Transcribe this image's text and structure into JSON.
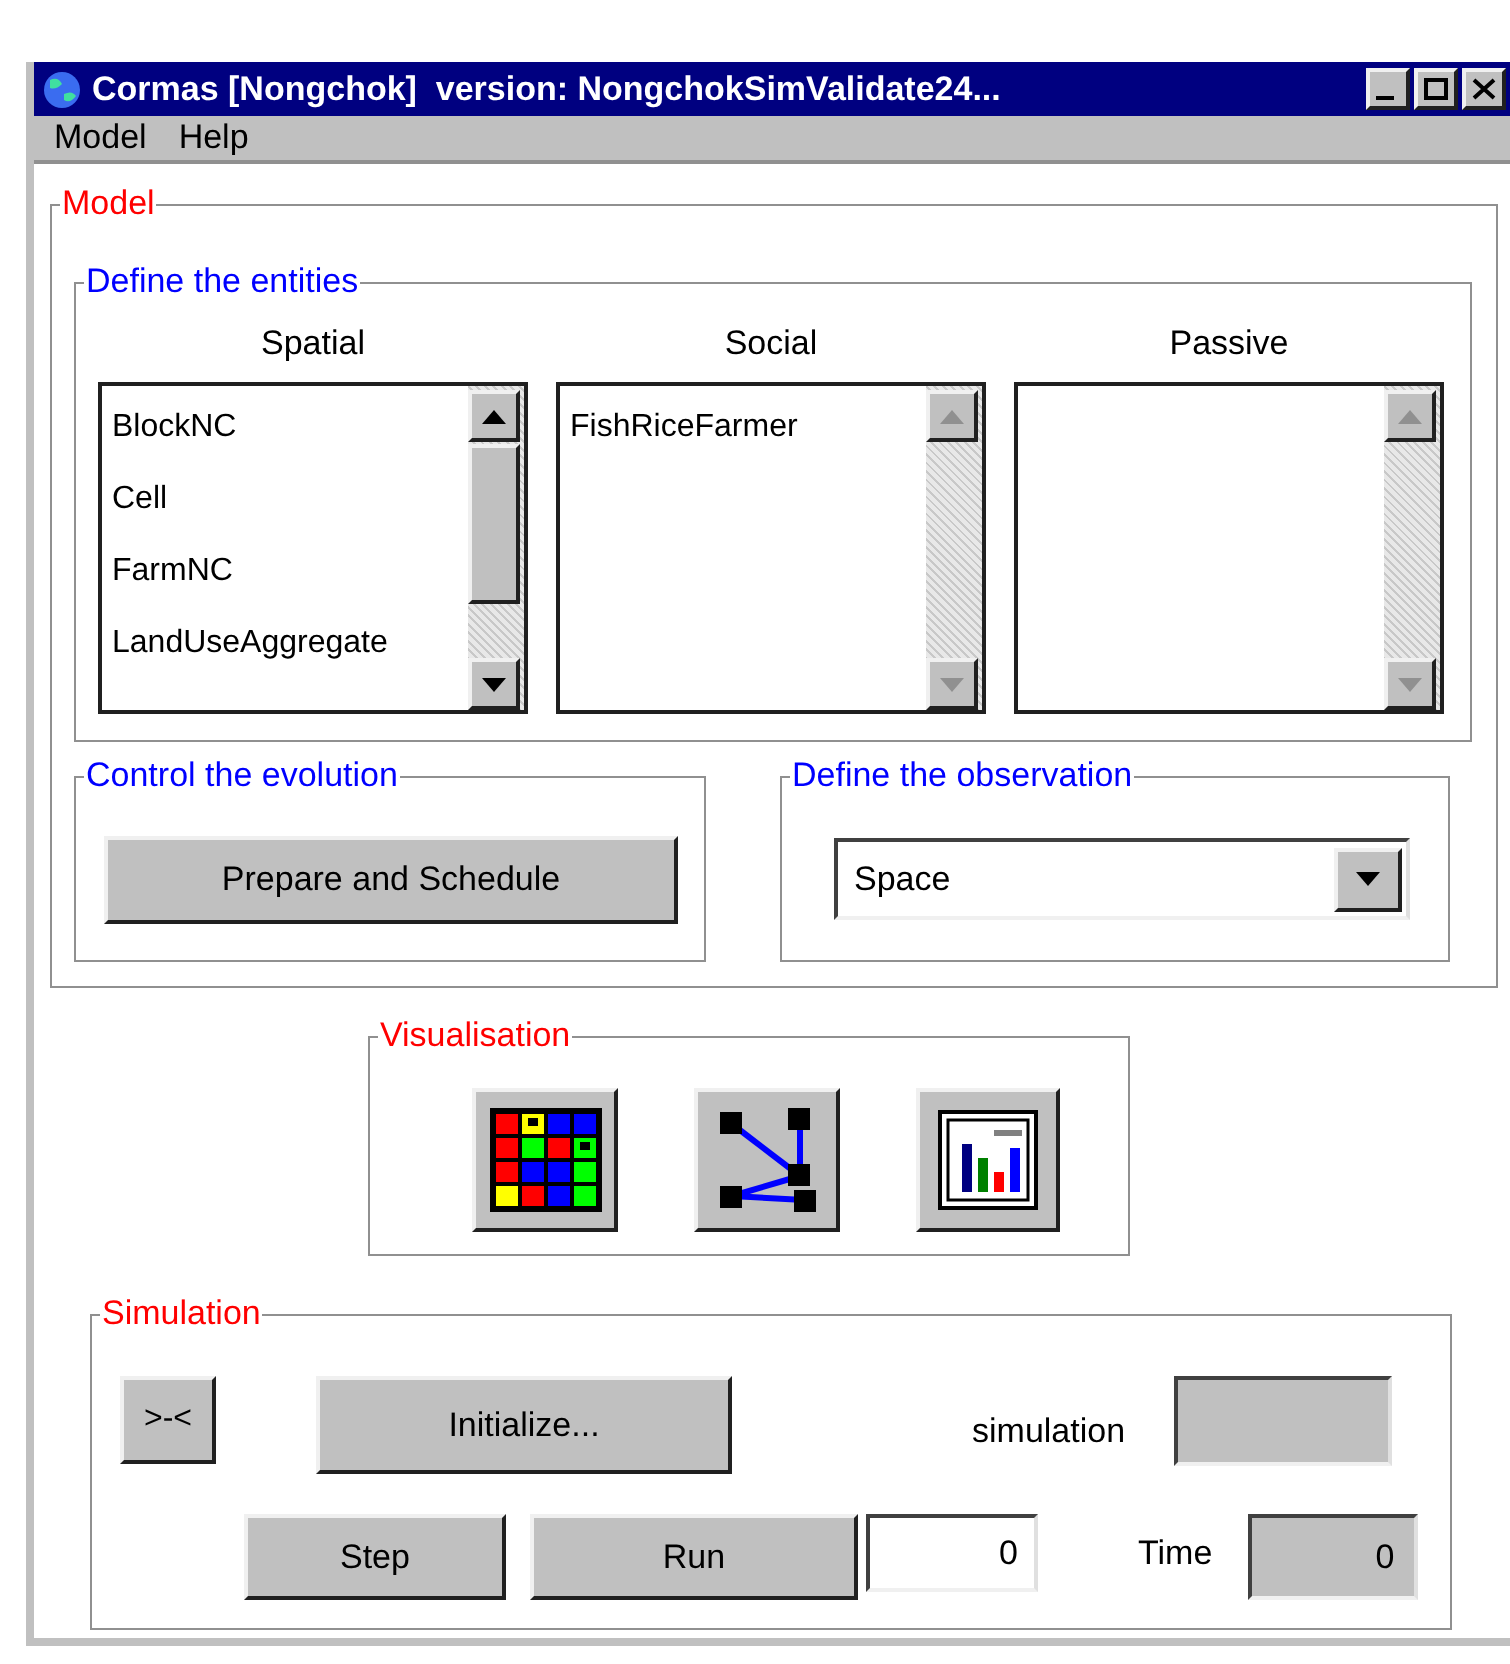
{
  "window": {
    "title": "Cormas [Nongchok]  version: NongchokSimValidate24..."
  },
  "menu": [
    "Model",
    "Help"
  ],
  "model": {
    "title": "Model",
    "entities": {
      "title": "Define the entities",
      "lists": [
        {
          "heading": "Spatial",
          "items": [
            "BlockNC",
            "Cell",
            "FarmNC",
            "LandUseAggregate"
          ],
          "scrollable": true
        },
        {
          "heading": "Social",
          "items": [
            "FishRiceFarmer"
          ],
          "scrollable": false
        },
        {
          "heading": "Passive",
          "scrollable": false
        }
      ]
    },
    "evolution": {
      "title": "Control the evolution",
      "button": "Prepare and Schedule"
    },
    "observation": {
      "title": "Define the observation",
      "value": "Space"
    }
  },
  "visualisation": {
    "title": "Visualisation"
  },
  "simulation": {
    "title": "Simulation",
    "collapse_button": ">-<",
    "initialize_button": "Initialize...",
    "simulation_label": "simulation",
    "step_button": "Step",
    "run_button": "Run",
    "steps_value": "0",
    "time_label": "Time",
    "time_value": "0"
  }
}
